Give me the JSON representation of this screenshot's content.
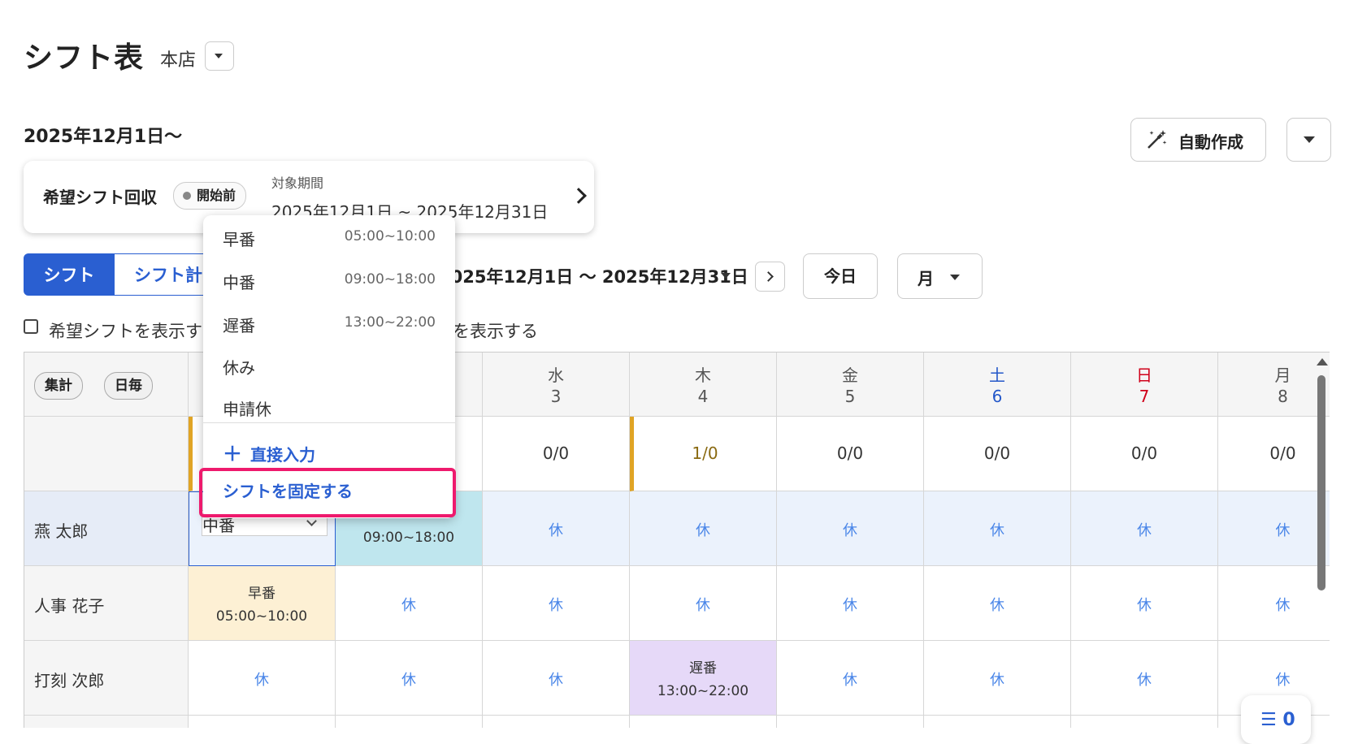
{
  "header": {
    "title": "シフト表",
    "store": "本店"
  },
  "period_label": "2025年12月1日〜",
  "auto_create_label": "自動作成",
  "kibou": {
    "title": "希望シフト回収",
    "status": "開始前",
    "period_label": "対象期間",
    "period_range": "2025年12月1日 ~ 2025年12月31日"
  },
  "tabs": {
    "shift": "シフト",
    "plan": "シフト計画"
  },
  "range": "2025年12月1日 〜 2025年12月31日",
  "today_label": "今日",
  "view_label": "月",
  "checkbox1": "希望シフトを表示す",
  "checkbox2": "を表示する",
  "buttons": {
    "summary": "集計",
    "daily": "日毎"
  },
  "days": [
    {
      "dow": "水",
      "num": "3",
      "count": "0/0"
    },
    {
      "dow": "木",
      "num": "4",
      "count": "1/0"
    },
    {
      "dow": "金",
      "num": "5",
      "count": "0/0"
    },
    {
      "dow": "土",
      "num": "6",
      "count": "0/0"
    },
    {
      "dow": "日",
      "num": "7",
      "count": "0/0"
    },
    {
      "dow": "月",
      "num": "8",
      "count": "0/0"
    }
  ],
  "staff": [
    {
      "name": "燕 太郎"
    },
    {
      "name": "人事 花子"
    },
    {
      "name": "打刻 次郎"
    }
  ],
  "off_label": "休",
  "shifts": {
    "tsubame_tue_time": "09:00~18:00",
    "hanako_mon_name": "早番",
    "hanako_mon_time": "05:00~10:00",
    "jiro_thu_name": "遅番",
    "jiro_thu_time": "13:00~22:00"
  },
  "select_value": "中番",
  "menu": {
    "items": [
      {
        "label": "早番",
        "time": "05:00~10:00"
      },
      {
        "label": "中番",
        "time": "09:00~18:00"
      },
      {
        "label": "遅番",
        "time": "13:00~22:00"
      },
      {
        "label": "休み",
        "time": ""
      },
      {
        "label": "申請休",
        "time": ""
      }
    ],
    "direct_input": "直接入力",
    "fix_shift": "シフトを固定する"
  },
  "fab_label": "☰ 0",
  "colors": {
    "accent": "#2a5fd1",
    "highlight": "#ee1a6d",
    "early": "#fdf0d4",
    "mid": "#bfe6ee",
    "late": "#e6d9f8"
  }
}
